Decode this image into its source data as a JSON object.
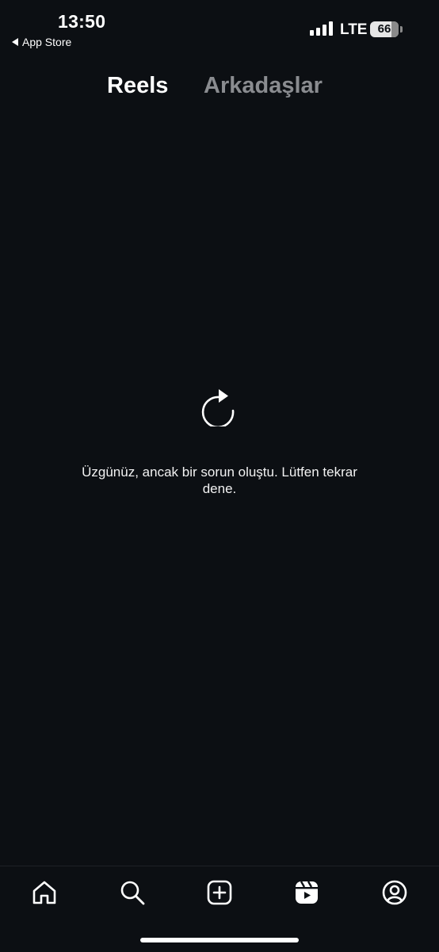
{
  "status_bar": {
    "time": "13:50",
    "back_label": "App Store",
    "network": "LTE",
    "battery": "66",
    "battery_level_percent": 66,
    "signal_icon": "signal-bars-icon"
  },
  "tabs": [
    {
      "label": "Reels",
      "active": true
    },
    {
      "label": "Arkadaşlar",
      "active": false
    }
  ],
  "error": {
    "icon": "reload-icon",
    "message": "Üzgünüz, ancak bir sorun oluştu. Lütfen tekrar dene."
  },
  "bottom_nav": [
    {
      "icon": "home-icon"
    },
    {
      "icon": "search-icon"
    },
    {
      "icon": "create-icon"
    },
    {
      "icon": "reels-icon",
      "active": true
    },
    {
      "icon": "profile-icon"
    }
  ],
  "colors": {
    "background": "#0c0f13",
    "text_primary": "#ffffff",
    "text_inactive": "#8a8c90"
  }
}
